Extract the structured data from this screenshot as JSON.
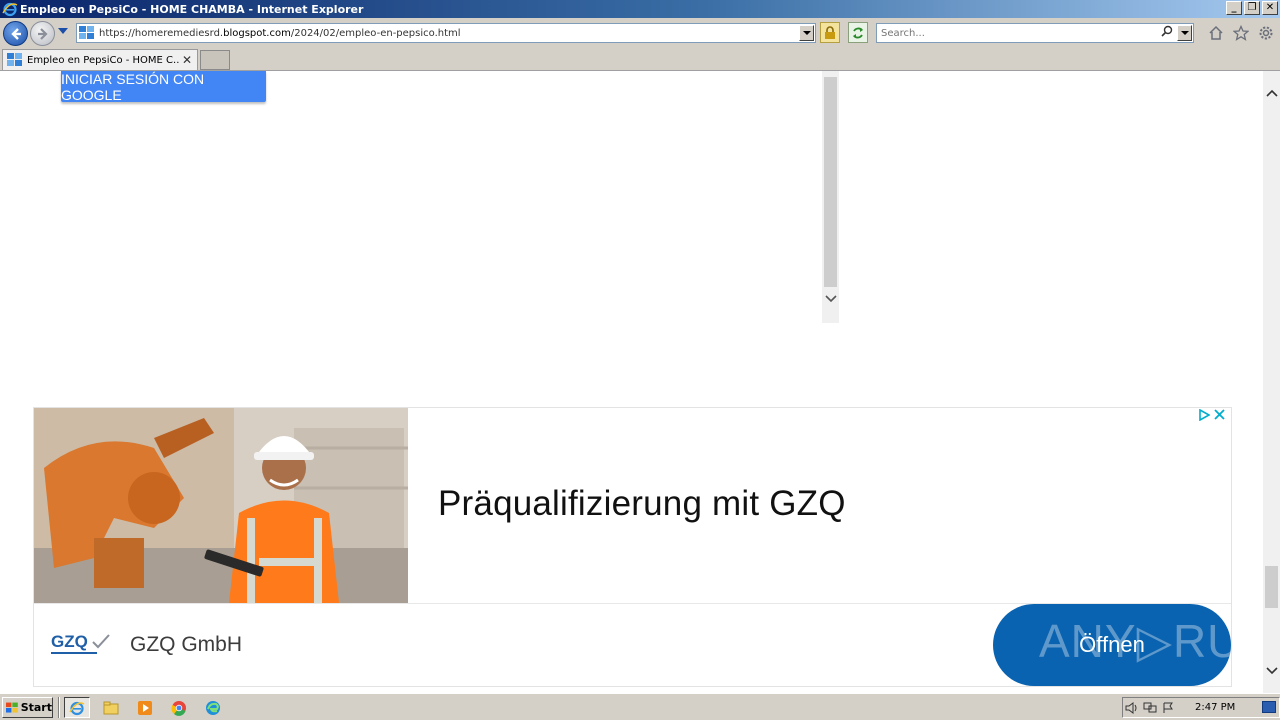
{
  "window": {
    "title": "Empleo en PepsiCo - HOME CHAMBA - Internet Explorer",
    "controls": {
      "minimize": "_",
      "restore": "❐",
      "close": "✕"
    }
  },
  "navbar": {
    "url_scheme": "https://",
    "url_sub": "homeremediesrd.",
    "url_domain": "blogspot.com",
    "url_path": "/2024/02/empleo-en-pepsico.html",
    "search_placeholder": "Search..."
  },
  "tabs": [
    {
      "title": "Empleo en PepsiCo - HOME C...",
      "active": true
    }
  ],
  "content": {
    "google_button_label": "INICIAR SESIÓN CON GOOGLE",
    "ad": {
      "headline": "Präqualifizierung mit GZQ",
      "advertiser": "GZQ GmbH",
      "cta_label": "Öffnen",
      "watermark": "ANY▷RUN",
      "logo_text": "GZQ"
    }
  },
  "taskbar": {
    "start_label": "Start",
    "clock": "2:47 PM"
  },
  "colors": {
    "google_blue": "#4285f4",
    "cta_blue": "#0a63b0",
    "adchoices_cyan": "#00aecd",
    "system_gray": "#d4d0c8"
  },
  "icons": [
    "ie-logo-icon",
    "back-icon",
    "forward-icon",
    "lock-icon",
    "refresh-icon",
    "search-icon",
    "home-icon",
    "favorites-icon",
    "settings-icon",
    "close-icon",
    "adchoices-icon",
    "start-flag-icon",
    "explorer-icon",
    "media-player-icon",
    "chrome-icon",
    "edge-icon",
    "volume-icon",
    "network-icon",
    "flag-icon"
  ]
}
